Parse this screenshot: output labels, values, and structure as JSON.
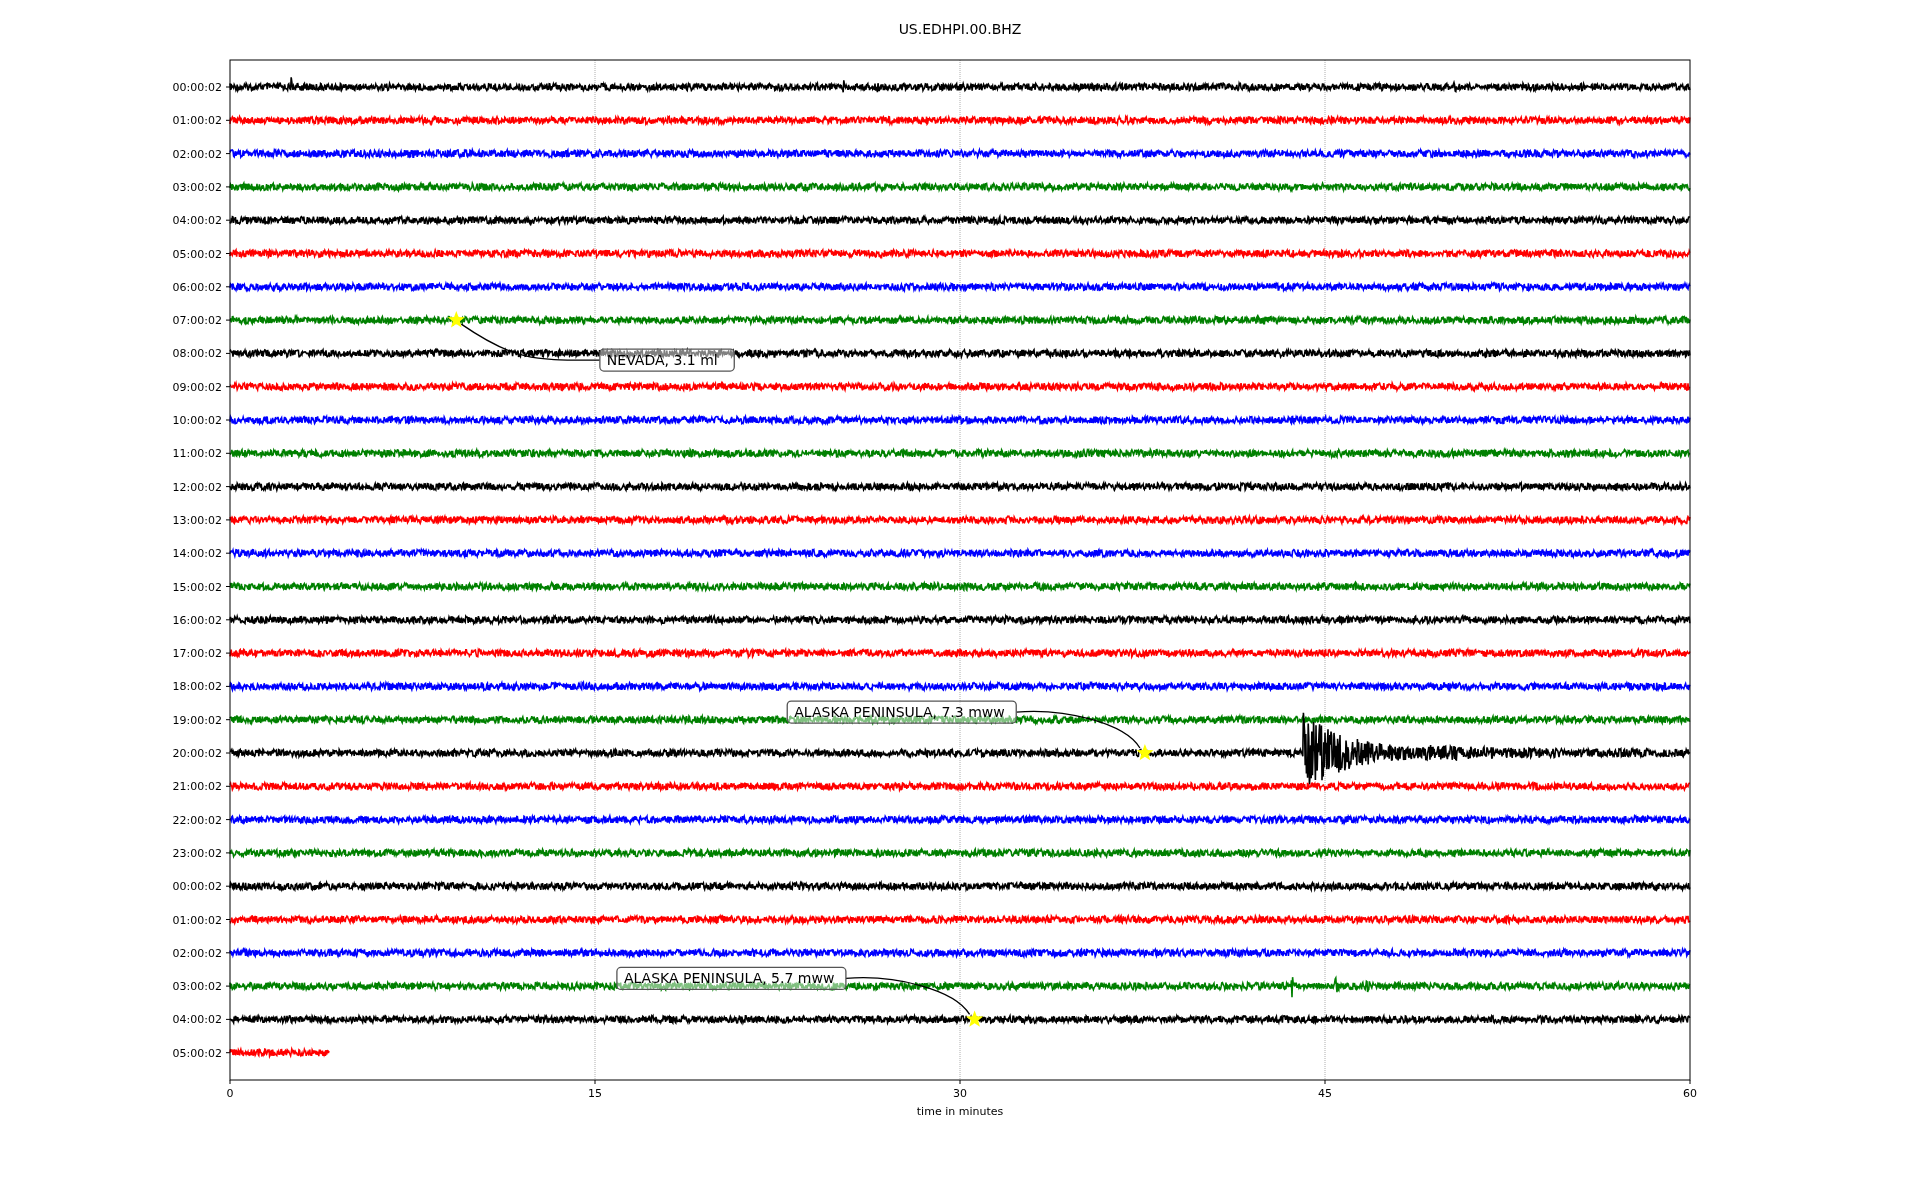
{
  "title": "US.EDHPI.00.BHZ",
  "xlabel": "time in minutes",
  "xticks": [
    "0",
    "15",
    "30",
    "45",
    "60"
  ],
  "rows": [
    {
      "label": "00:00:02",
      "color": "#000000",
      "level": 1
    },
    {
      "label": "01:00:02",
      "color": "#ff0000",
      "level": 1
    },
    {
      "label": "02:00:02",
      "color": "#0000ff",
      "level": 1
    },
    {
      "label": "03:00:02",
      "color": "#008000",
      "level": 1
    },
    {
      "label": "04:00:02",
      "color": "#000000",
      "level": 1
    },
    {
      "label": "05:00:02",
      "color": "#ff0000",
      "level": 1
    },
    {
      "label": "06:00:02",
      "color": "#0000ff",
      "level": 1
    },
    {
      "label": "07:00:02",
      "color": "#008000",
      "level": 1,
      "event": "NEVADA, 3.1 ml"
    },
    {
      "label": "08:00:02",
      "color": "#000000",
      "level": 1
    },
    {
      "label": "09:00:02",
      "color": "#ff0000",
      "level": 1
    },
    {
      "label": "10:00:02",
      "color": "#0000ff",
      "level": 1
    },
    {
      "label": "11:00:02",
      "color": "#008000",
      "level": 1
    },
    {
      "label": "12:00:02",
      "color": "#000000",
      "level": 1
    },
    {
      "label": "13:00:02",
      "color": "#ff0000",
      "level": 1
    },
    {
      "label": "14:00:02",
      "color": "#0000ff",
      "level": 1
    },
    {
      "label": "15:00:02",
      "color": "#008000",
      "level": 1
    },
    {
      "label": "16:00:02",
      "color": "#000000",
      "level": 1
    },
    {
      "label": "17:00:02",
      "color": "#ff0000",
      "level": 1
    },
    {
      "label": "18:00:02",
      "color": "#0000ff",
      "level": 1
    },
    {
      "label": "19:00:02",
      "color": "#008000",
      "level": 1
    },
    {
      "label": "20:00:02",
      "color": "#000000",
      "level": 1,
      "event": "ALASKA PENINSULA, 7.3 mww"
    },
    {
      "label": "21:00:02",
      "color": "#ff0000",
      "level": 1
    },
    {
      "label": "22:00:02",
      "color": "#0000ff",
      "level": 1
    },
    {
      "label": "23:00:02",
      "color": "#008000",
      "level": 1
    },
    {
      "label": "00:00:02",
      "color": "#000000",
      "level": 1
    },
    {
      "label": "01:00:02",
      "color": "#ff0000",
      "level": 1
    },
    {
      "label": "02:00:02",
      "color": "#0000ff",
      "level": 1
    },
    {
      "label": "03:00:02",
      "color": "#008000",
      "level": 1
    },
    {
      "label": "04:00:02",
      "color": "#000000",
      "level": 1,
      "event": "ALASKA PENINSULA, 5.7 mww"
    },
    {
      "label": "05:00:02",
      "color": "#ff0000",
      "level": 0.068
    }
  ]
}
